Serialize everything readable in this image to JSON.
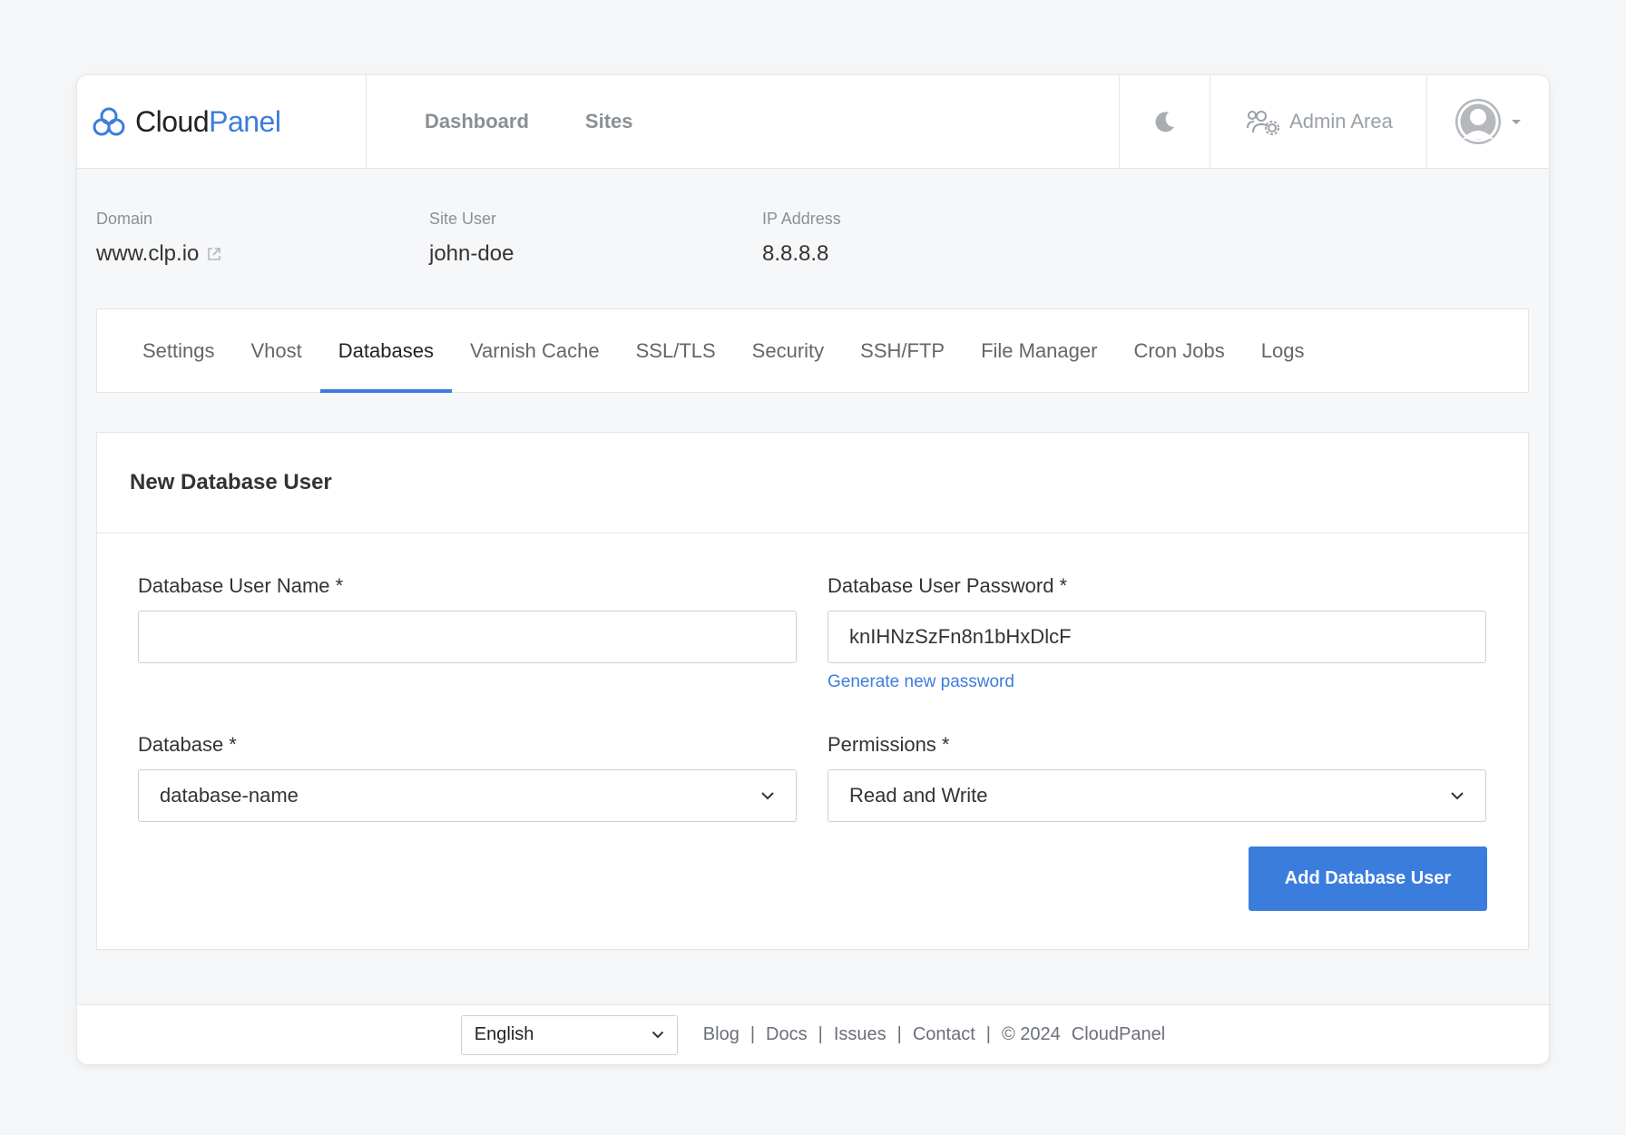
{
  "header": {
    "brand_part1": "Cloud",
    "brand_part2": "Panel",
    "nav": [
      {
        "label": "Dashboard"
      },
      {
        "label": "Sites"
      }
    ],
    "admin_label": "Admin Area"
  },
  "site_info": {
    "domain_label": "Domain",
    "domain_value": "www.clp.io",
    "user_label": "Site User",
    "user_value": "john-doe",
    "ip_label": "IP Address",
    "ip_value": "8.8.8.8"
  },
  "tabs": [
    {
      "label": "Settings",
      "active": false
    },
    {
      "label": "Vhost",
      "active": false
    },
    {
      "label": "Databases",
      "active": true
    },
    {
      "label": "Varnish Cache",
      "active": false
    },
    {
      "label": "SSL/TLS",
      "active": false
    },
    {
      "label": "Security",
      "active": false
    },
    {
      "label": "SSH/FTP",
      "active": false
    },
    {
      "label": "File Manager",
      "active": false
    },
    {
      "label": "Cron Jobs",
      "active": false
    },
    {
      "label": "Logs",
      "active": false
    }
  ],
  "form": {
    "title": "New Database User",
    "username_label": "Database User Name *",
    "username_value": "",
    "password_label": "Database User Password *",
    "password_value": "knIHNzSzFn8n1bHxDlcF",
    "generate_link": "Generate new password",
    "database_label": "Database *",
    "database_value": "database-name",
    "permissions_label": "Permissions *",
    "permissions_value": "Read and Write",
    "submit_label": "Add Database User"
  },
  "footer": {
    "language": "English",
    "links": [
      "Blog",
      "Docs",
      "Issues",
      "Contact"
    ],
    "copyright": "© 2024",
    "brand": "CloudPanel"
  },
  "colors": {
    "accent": "#3b7ddd",
    "border": "#e3e5e8",
    "background": "#f6f7f9"
  }
}
